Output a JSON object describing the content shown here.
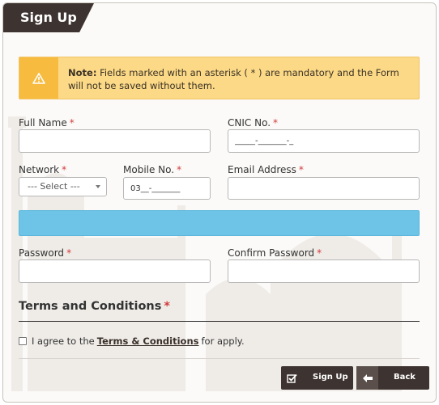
{
  "header": {
    "title": "Sign Up"
  },
  "note": {
    "icon": "warning-icon",
    "bold": "Note:",
    "text": "Fields marked with an asterisk ( * ) are mandatory and the Form will not be saved without them."
  },
  "form": {
    "required_mark": "*",
    "full_name": {
      "label": "Full Name",
      "value": ""
    },
    "cnic": {
      "label": "CNIC No.",
      "value": "_____-_______-_"
    },
    "network": {
      "label": "Network",
      "selected": "--- Select ---"
    },
    "mobile": {
      "label": "Mobile No.",
      "value": "03__-_______"
    },
    "email": {
      "label": "Email Address",
      "value": ""
    },
    "password": {
      "label": "Password",
      "value": ""
    },
    "confirm_password": {
      "label": "Confirm Password",
      "value": ""
    }
  },
  "terms": {
    "heading": "Terms and Conditions",
    "agree_prefix": "I agree to the",
    "agree_link": "Terms & Conditions",
    "agree_suffix": "for apply."
  },
  "actions": {
    "signup_label": "Sign Up",
    "signup_icon": "check-square-icon",
    "back_label": "Back",
    "back_icon": "arrow-left-icon"
  },
  "colors": {
    "brand_dark": "#3d3330",
    "note_bg": "#fbd986",
    "note_icon_bg": "#f7bb3f",
    "info_bar": "#6ec4e6",
    "required": "#d23b3b"
  }
}
